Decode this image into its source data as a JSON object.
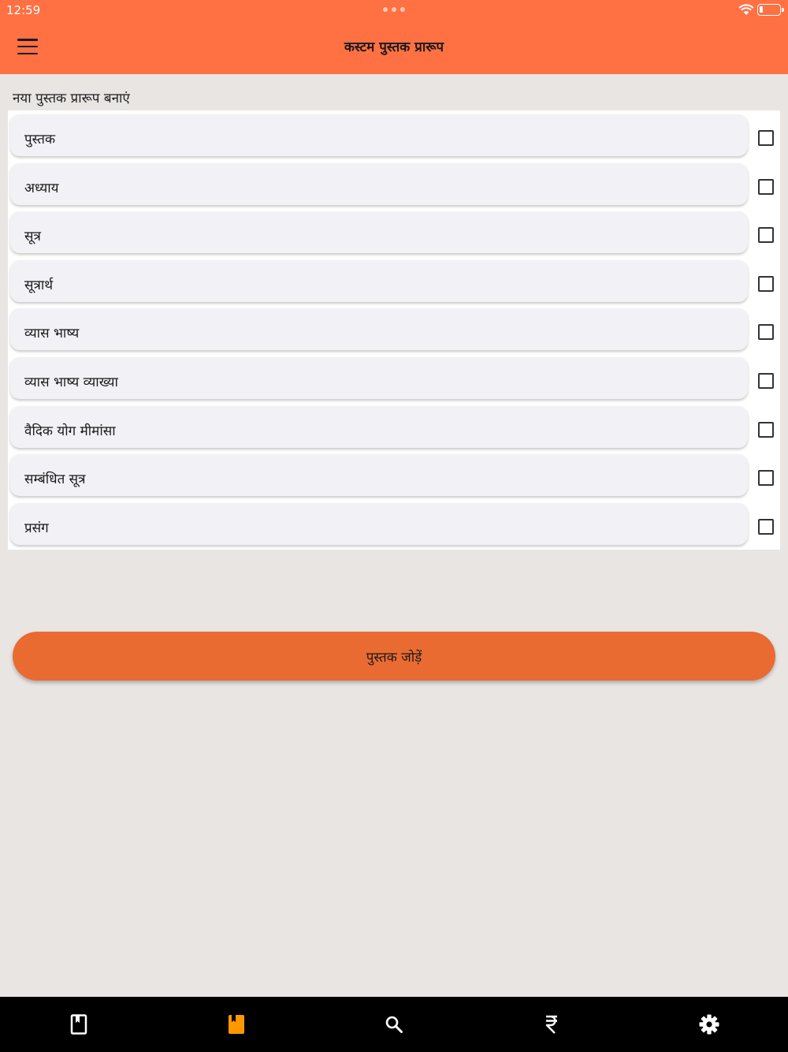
{
  "status_bar": {
    "time": "12:59"
  },
  "app_bar": {
    "title": "कस्टम पुस्तक प्रारूप",
    "menu_icon": "hamburger-menu-icon"
  },
  "section": {
    "label": "नया पुस्तक प्रारूप बनाएं"
  },
  "fields": [
    {
      "label": "पुस्तक",
      "checked": false
    },
    {
      "label": "अध्याय",
      "checked": false
    },
    {
      "label": "सूत्र",
      "checked": false
    },
    {
      "label": "सूत्रार्थ",
      "checked": false
    },
    {
      "label": "व्यास भाष्य",
      "checked": false
    },
    {
      "label": "व्यास भाष्य व्याख्या",
      "checked": false
    },
    {
      "label": "वैदिक योग मीमांसा",
      "checked": false
    },
    {
      "label": "सम्बंधित सूत्र",
      "checked": false
    },
    {
      "label": "प्रसंग",
      "checked": false
    }
  ],
  "add_button": {
    "label": "पुस्तक जोड़ें"
  },
  "tabs": [
    {
      "icon": "bookmark-book-icon",
      "active": false
    },
    {
      "icon": "book-icon",
      "active": true
    },
    {
      "icon": "search-icon",
      "active": false
    },
    {
      "icon": "rupee-icon",
      "active": false
    },
    {
      "icon": "settings-gear-icon",
      "active": false
    }
  ],
  "colors": {
    "primary": "#ff7043",
    "button": "#e96b32",
    "active_tab": "#ff9800",
    "tab_icon": "#ffffff",
    "background": "#e8e5e3",
    "tabbar": "#000000"
  }
}
